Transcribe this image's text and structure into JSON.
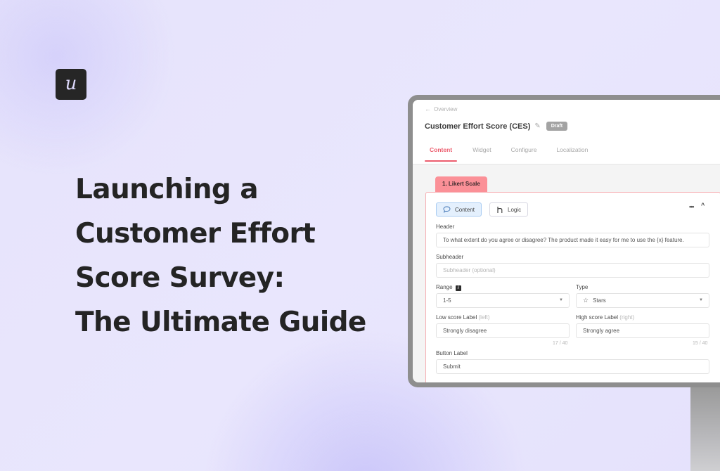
{
  "brand": {
    "logo_letter": "u"
  },
  "hero": {
    "title_lines": [
      "Launching a",
      "Customer Effort",
      "Score Survey:",
      "The Ultimate Guide"
    ]
  },
  "app": {
    "back_link": {
      "icon": "arrow-left-icon",
      "label": "Overview"
    },
    "survey_title": "Customer Effort Score (CES)",
    "edit_icon": "pencil-icon",
    "status_badge": "Draft",
    "tabs": [
      {
        "label": "Content",
        "active": true
      },
      {
        "label": "Widget",
        "active": false
      },
      {
        "label": "Configure",
        "active": false
      },
      {
        "label": "Localization",
        "active": false
      }
    ],
    "question_tab": "1. Likert Scale",
    "modes": {
      "content": {
        "label": "Content",
        "icon": "speech-bubble-icon",
        "active": true
      },
      "logic": {
        "label": "Logic",
        "icon": "logic-branch-icon",
        "active": false
      }
    },
    "more_icon": "•••",
    "collapse_icon": "^",
    "fields": {
      "header": {
        "label": "Header",
        "value": "To what extent do you agree or disagree? The product made it easy for me to use the {x} feature."
      },
      "subheader": {
        "label": "Subheader",
        "placeholder": "Subheader (optional)"
      },
      "range": {
        "label": "Range",
        "info_icon": "i",
        "value": "1-5"
      },
      "type": {
        "label": "Type",
        "value": "Stars",
        "icon": "star-icon"
      },
      "low_score": {
        "label": "Low score Label",
        "hint": "(left)",
        "value": "Strongly disagree",
        "counter": "17 / 40"
      },
      "high_score": {
        "label": "High score Label",
        "hint": "(right)",
        "value": "Strongly agree",
        "counter": "15 / 40"
      },
      "button_label": {
        "label": "Button Label",
        "value": "Submit"
      }
    }
  },
  "colors": {
    "accent": "#ec5d6e",
    "question_tab": "#fb9097",
    "background": "#e6e3fb",
    "text_dark": "#242424"
  }
}
